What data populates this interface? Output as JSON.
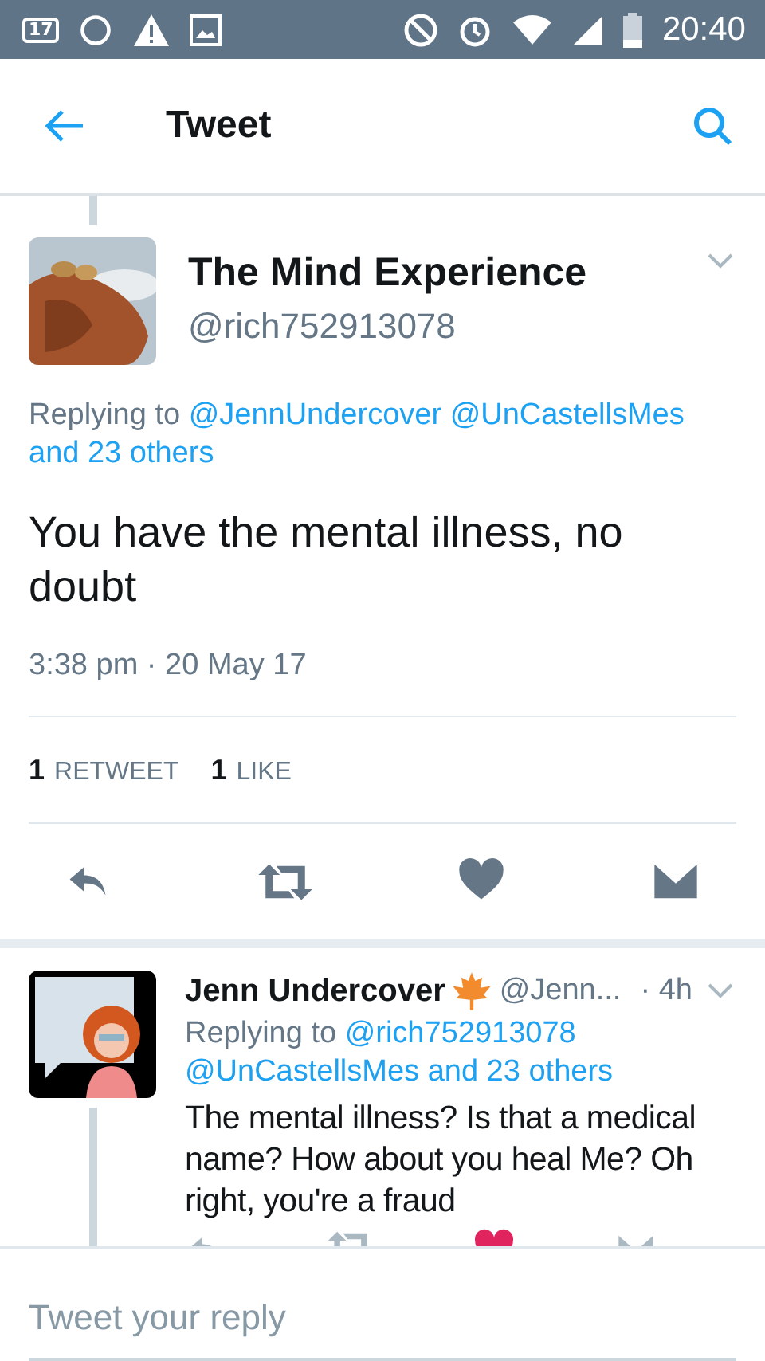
{
  "status_bar": {
    "notification_badge": "17",
    "time": "20:40"
  },
  "header": {
    "title": "Tweet"
  },
  "tweet": {
    "name": "The Mind Experience",
    "handle": "@rich752913078",
    "replying_prefix": "Replying to",
    "replying_to": "@JennUndercover @UnCastellsMes and 23 others",
    "text": "You have the mental illness, no doubt",
    "timestamp": "3:38 pm · 20 May 17",
    "stats": [
      {
        "count": "1",
        "label": "RETWEET"
      },
      {
        "count": "1",
        "label": "LIKE"
      }
    ],
    "liked": false
  },
  "reply": {
    "name": "Jenn Undercover",
    "handle": "@Jenn...",
    "age": "· 4h",
    "replying_prefix": "Replying to",
    "replying_to": "@rich752913078 @UnCastellsMes and 23 others",
    "text": "The mental illness? Is that a medical name? How about you heal Me? Oh right, you're a fraud",
    "liked": true
  },
  "composer": {
    "placeholder": "Tweet your reply"
  }
}
